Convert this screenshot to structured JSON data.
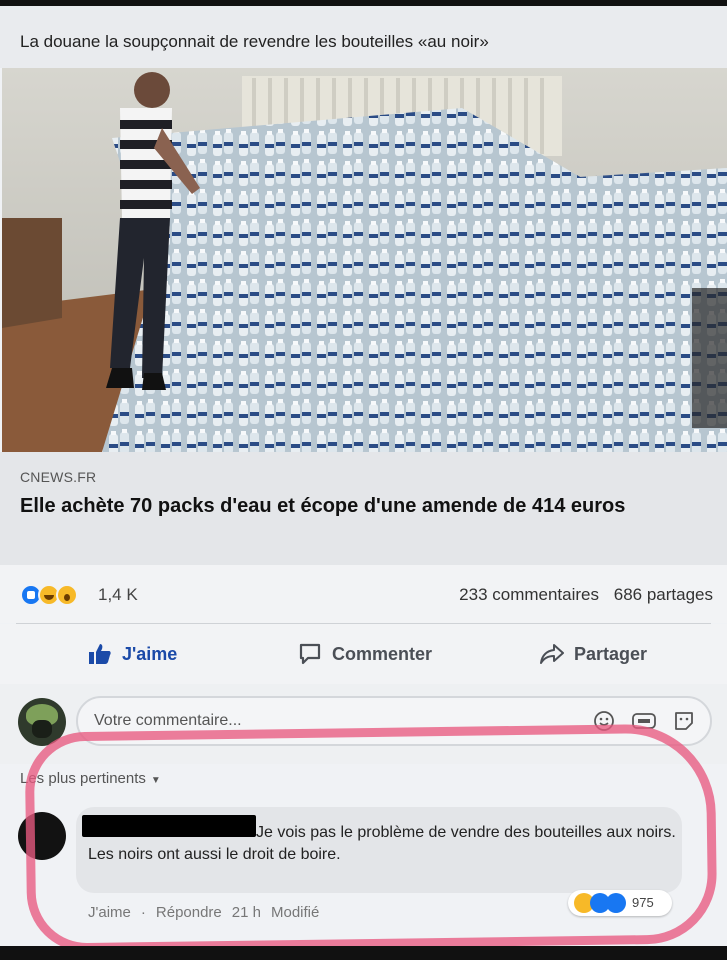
{
  "post": {
    "text": "La douane la soupçonnait de revendre les bouteilles «au noir»"
  },
  "link": {
    "domain": "CNEWS.FR",
    "title": "Elle achète 70 packs d'eau et écope d'une amende de 414 euros"
  },
  "stats": {
    "reactions_count": "1,4 K",
    "comments": "233 commentaires",
    "shares": "686 partages",
    "reaction_icons": [
      "like-icon",
      "haha-icon",
      "wow-icon"
    ]
  },
  "actions": {
    "like": "J'aime",
    "comment": "Commenter",
    "share": "Partager"
  },
  "composer": {
    "placeholder": "Votre commentaire..."
  },
  "comments": {
    "sort_label": "Les plus pertinents",
    "items": [
      {
        "text": "Je vois pas le problème de vendre des bouteilles aux noirs.\nLes noirs ont aussi le droit de boire.",
        "like": "J'aime",
        "reply": "Répondre",
        "time": "21 h",
        "edited": "Modifié",
        "reactions_count": "975"
      }
    ]
  },
  "colors": {
    "facebook_blue": "#1877f2",
    "highlight": "#e85a80",
    "background": "#f0f2f5"
  }
}
